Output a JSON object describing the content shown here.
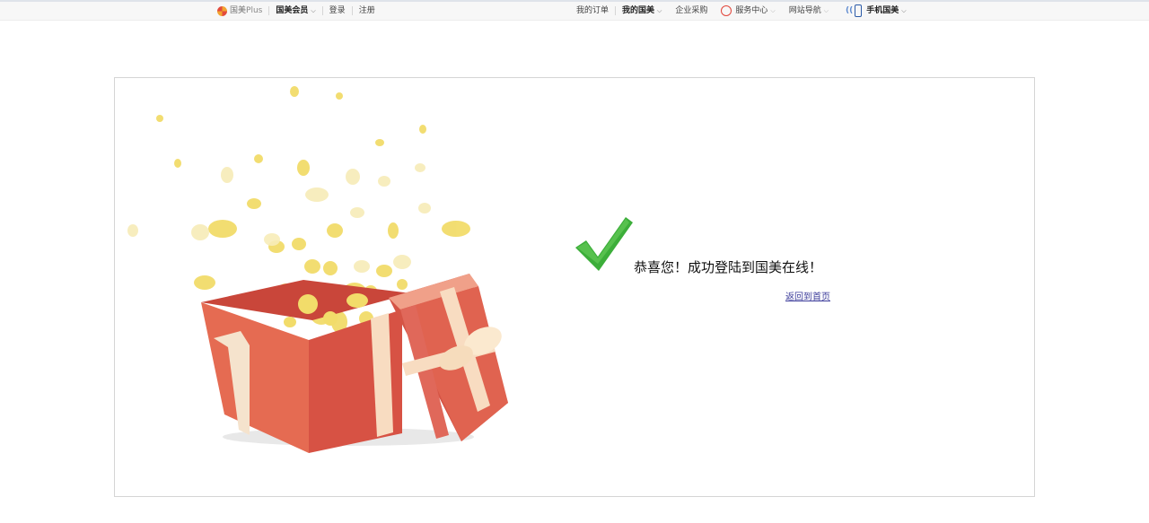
{
  "topbar": {
    "plus_brand": "国美",
    "plus_suffix": "Plus",
    "member": "国美会员",
    "login": "登录",
    "register": "注册",
    "orders": "我的订单",
    "my_gome": "我的国美",
    "enterprise": "企业采购",
    "service": "服务中心",
    "sitenav": "网站导航",
    "mobile": "手机国美"
  },
  "main": {
    "success_message": "恭喜您！成功登陆到国美在线！",
    "home_link": "返回到首页"
  },
  "colors": {
    "check_green": "#3cae3a",
    "box_red": "#e35b47",
    "ribbon": "#f8dcc1",
    "confetti": "#f1d968"
  },
  "icons": [
    "plus-logo-icon",
    "service-icon",
    "phone-icon",
    "checkmark-icon",
    "gift-box-illustration"
  ]
}
